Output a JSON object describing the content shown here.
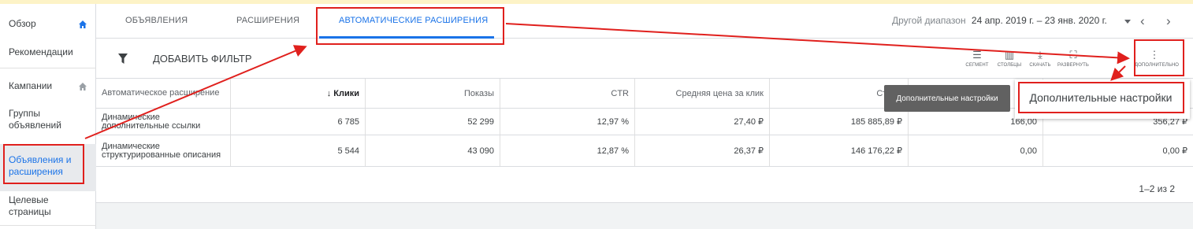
{
  "sidebar": {
    "items": [
      {
        "label": "Обзор",
        "icon": "home-icon"
      },
      {
        "label": "Рекомендации"
      },
      {
        "label": "Кампании",
        "icon": "home-icon"
      },
      {
        "label": "Группы объявлений"
      },
      {
        "label": "Объявления и расширения"
      },
      {
        "label": "Целевые страницы"
      }
    ]
  },
  "tabs": [
    {
      "label": "ОБЪЯВЛЕНИЯ"
    },
    {
      "label": "РАСШИРЕНИЯ"
    },
    {
      "label": "АВТОМАТИЧЕСКИЕ РАСШИРЕНИЯ",
      "active": true
    }
  ],
  "date_range": {
    "label": "Другой диапазон",
    "value": "24 апр. 2019 г. – 23 янв. 2020 г."
  },
  "toolbar": {
    "filter_label": "ДОБАВИТЬ ФИЛЬТР",
    "tools": [
      {
        "label": "СЕГМЕНТ",
        "icon": "segment-icon"
      },
      {
        "label": "СТОЛБЦЫ",
        "icon": "columns-icon"
      },
      {
        "label": "СКАЧАТЬ",
        "icon": "download-icon"
      },
      {
        "label": "РАЗВЕРНУТЬ",
        "icon": "fullscreen-icon"
      },
      {
        "label": "ДОПОЛНИТЕЛЬНО",
        "icon": "more-vert-icon"
      }
    ]
  },
  "table": {
    "headers": [
      "Автоматическое расширение",
      "↓ Клики",
      "Показы",
      "CTR",
      "Средняя цена за клик",
      "Стоим",
      "в"
    ],
    "rows": [
      [
        "Динамические дополнительные ссылки",
        "6 785",
        "52 299",
        "12,97 %",
        "27,40 ₽",
        "185 885,89 ₽",
        "166,00",
        "356,27 ₽"
      ],
      [
        "Динамические структурированные описания",
        "5 544",
        "43 090",
        "12,87 %",
        "26,37 ₽",
        "146 176,22 ₽",
        "0,00",
        "0,00 ₽"
      ]
    ],
    "pagination": "1–2 из 2"
  },
  "tooltip": "Дополнительные настройки",
  "menu": {
    "item": "Дополнительные настройки"
  },
  "colors": {
    "accent": "#1a73e8",
    "annotation": "#e0201d"
  }
}
